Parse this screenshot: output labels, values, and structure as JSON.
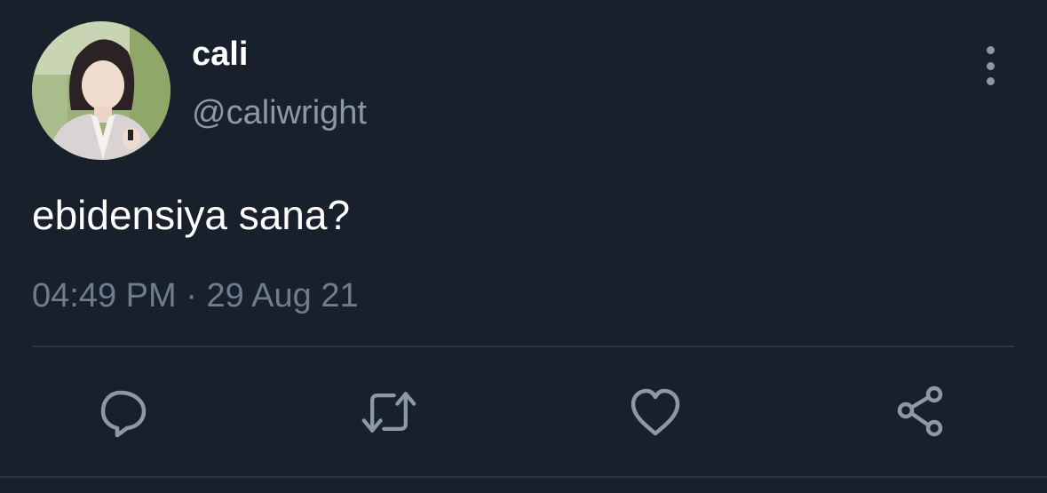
{
  "tweet": {
    "display_name": "cali",
    "handle": "@caliwright",
    "text": "ebidensiya sana?",
    "time": "04:49 PM",
    "separator": "·",
    "date": "29 Aug 21"
  },
  "actions": [
    {
      "name": "reply",
      "icon": "reply-icon"
    },
    {
      "name": "retweet",
      "icon": "retweet-icon"
    },
    {
      "name": "like",
      "icon": "heart-icon"
    },
    {
      "name": "share",
      "icon": "share-icon"
    }
  ],
  "colors": {
    "background": "#17202b",
    "text_primary": "#ffffff",
    "text_secondary": "#8b98a5",
    "icon": "#8b98a5",
    "divider": "#2c3640"
  }
}
